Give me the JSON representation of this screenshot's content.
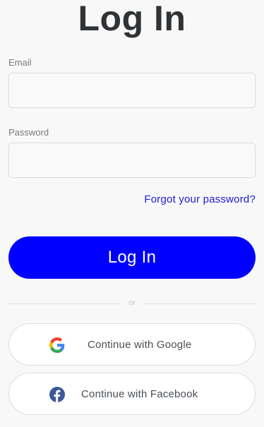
{
  "title": "Log In",
  "email": {
    "label": "Email",
    "value": "",
    "placeholder": ""
  },
  "password": {
    "label": "Password",
    "value": "",
    "placeholder": ""
  },
  "forgot_password": "Forgot your password?",
  "login_button": "Log In",
  "divider_text": "or",
  "social": {
    "google": {
      "label": "Continue with Google",
      "icon": "google-icon"
    },
    "facebook": {
      "label": "Continue with Facebook",
      "icon": "facebook-icon",
      "color": "#3b5998"
    }
  },
  "colors": {
    "primary": "#0000ff",
    "link": "#1a1ad4",
    "background": "#f8f8f8",
    "title": "#303336"
  }
}
